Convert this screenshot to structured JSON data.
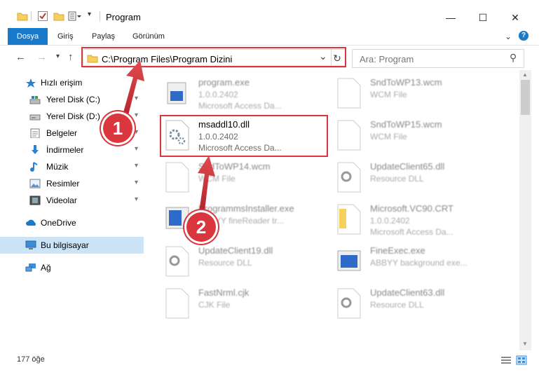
{
  "window": {
    "title": "Program",
    "minimize": "—",
    "maximize": "☐",
    "close": "✕"
  },
  "ribbon": {
    "tabs": [
      "Dosya",
      "Giriş",
      "Paylaş",
      "Görünüm"
    ],
    "help_icon": "?"
  },
  "address": {
    "path": "C:\\Program Files\\Program Dizini",
    "refresh_icon": "↻",
    "back": "←",
    "forward": "→",
    "recent": "▾",
    "up": "↑",
    "dropdown": "⌄"
  },
  "search": {
    "placeholder": "Ara: Program",
    "icon": "⚲"
  },
  "sidebar": {
    "items": [
      {
        "label": "Hızlı erişim",
        "pinned": false
      },
      {
        "label": "Yerel Disk (C:)",
        "pinned": true
      },
      {
        "label": "Yerel Disk (D:)",
        "pinned": true
      },
      {
        "label": "Belgeler",
        "pinned": true
      },
      {
        "label": "İndirmeler",
        "pinned": true
      },
      {
        "label": "Müzik",
        "pinned": true
      },
      {
        "label": "Resimler",
        "pinned": true
      },
      {
        "label": "Videolar",
        "pinned": true
      },
      {
        "label": "OneDrive",
        "pinned": false
      },
      {
        "label": "Bu bilgisayar",
        "pinned": false
      },
      {
        "label": "Ağ",
        "pinned": false
      }
    ],
    "pin_glyph": "📌"
  },
  "files": {
    "left": [
      {
        "name": "program.exe",
        "line2": "1.0.0.2402",
        "line3": "Microsoft Access Da..."
      },
      {
        "name": "msaddl10.dll",
        "line2": "1.0.0.2402",
        "line3": "Microsoft Access Da..."
      },
      {
        "name": "SndToWP14.wcm",
        "line2": "WCM File",
        "line3": ""
      },
      {
        "name": "ProgrammsInstaller.exe",
        "line2": "ABBYY fineReader tr...",
        "line3": ""
      },
      {
        "name": "UpdateClient19.dll",
        "line2": "Resource DLL",
        "line3": ""
      },
      {
        "name": "FastNrml.cjk",
        "line2": "CJK File",
        "line3": ""
      }
    ],
    "right": [
      {
        "name": "SndToWP13.wcm",
        "line2": "WCM File",
        "line3": ""
      },
      {
        "name": "SndToWP15.wcm",
        "line2": "WCM File",
        "line3": ""
      },
      {
        "name": "UpdateClient65.dll",
        "line2": "Resource DLL",
        "line3": ""
      },
      {
        "name": "Microsoft.VC90.CRT",
        "line2": "1.0.0.2402",
        "line3": "Microsoft Access Da..."
      },
      {
        "name": "FineExec.exe",
        "line2": "ABBYY background exe...",
        "line3": ""
      },
      {
        "name": "UpdateClient63.dll",
        "line2": "Resource DLL",
        "line3": ""
      }
    ]
  },
  "annotations": {
    "badge1": "1",
    "badge2": "2",
    "red": "#d9363e",
    "blue": "#2e6ac8"
  },
  "status": {
    "count": "177 öğe"
  }
}
